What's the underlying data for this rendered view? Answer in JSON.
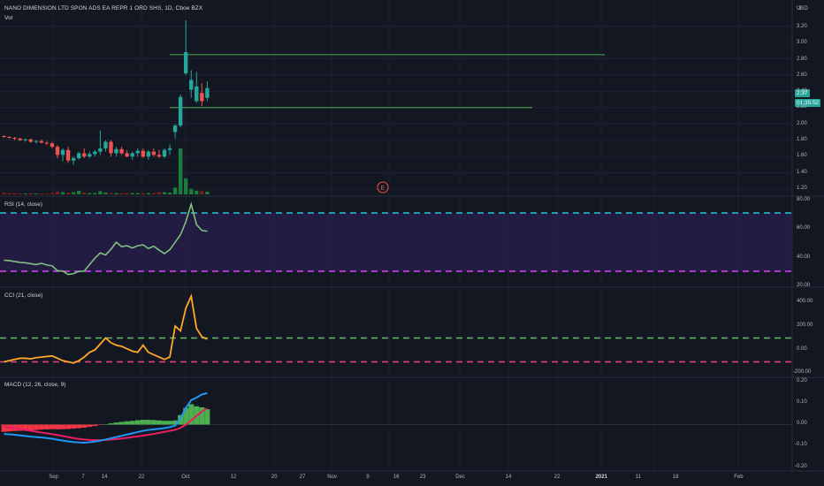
{
  "header": {
    "title": "NANO DIMENSION LTD SPON ADS EA REPR 1 ORD SHS, 1D, Cboe BZX",
    "vol_label": "Vol",
    "currency": "USD"
  },
  "price_axis": {
    "ticks": [
      "3",
      "3.20",
      "3.00",
      "2.80",
      "2.60",
      "2.40",
      "2.20",
      "2.00",
      "1.80",
      "1.60",
      "1.40",
      "1.20"
    ],
    "last_price": "2.37",
    "countdown": "01:35:52"
  },
  "rsi_axis": [
    "80.00",
    "60.00",
    "40.00",
    "20.00"
  ],
  "cci_axis": [
    "400.00",
    "200.00",
    "0.00",
    "-200.00"
  ],
  "macd_axis": [
    "0.20",
    "0.10",
    "0.00",
    "-0.10",
    "-0.20"
  ],
  "time_axis": [
    "Sep",
    "7",
    "14",
    "22",
    "Oct",
    "12",
    "20",
    "27",
    "Nov",
    "9",
    "16",
    "23",
    "Dec",
    "14",
    "22",
    "2021",
    "11",
    "18",
    "Feb"
  ],
  "earnings_marker": "E",
  "colors": {
    "up": "#26a69a",
    "down": "#ef5350",
    "rsi_line": "#7fbf7f",
    "cci_line": "#ffa726",
    "macd_line": "#2196f3",
    "signal_line": "#e91e63",
    "hist_pos": "#4caf50",
    "hist_neg": "#f23645"
  },
  "chart_data": [
    {
      "type": "candlestick",
      "title": "NANO DIMENSION LTD SPON ADS EA REPR 1 ORD SHS, 1D, Cboe BZX",
      "ylim": [
        1.1,
        3.3
      ],
      "candles": [
        [
          1.85,
          1.86,
          1.83,
          1.84
        ],
        [
          1.84,
          1.85,
          1.82,
          1.83
        ],
        [
          1.83,
          1.84,
          1.8,
          1.82
        ],
        [
          1.82,
          1.83,
          1.79,
          1.8
        ],
        [
          1.8,
          1.82,
          1.78,
          1.81
        ],
        [
          1.81,
          1.82,
          1.77,
          1.78
        ],
        [
          1.78,
          1.8,
          1.76,
          1.79
        ],
        [
          1.79,
          1.81,
          1.76,
          1.77
        ],
        [
          1.77,
          1.79,
          1.74,
          1.76
        ],
        [
          1.76,
          1.78,
          1.7,
          1.72
        ],
        [
          1.72,
          1.74,
          1.58,
          1.62
        ],
        [
          1.62,
          1.7,
          1.54,
          1.68
        ],
        [
          1.68,
          1.72,
          1.52,
          1.55
        ],
        [
          1.55,
          1.6,
          1.5,
          1.58
        ],
        [
          1.58,
          1.66,
          1.56,
          1.64
        ],
        [
          1.64,
          1.7,
          1.58,
          1.6
        ],
        [
          1.6,
          1.66,
          1.58,
          1.63
        ],
        [
          1.63,
          1.68,
          1.6,
          1.66
        ],
        [
          1.66,
          1.92,
          1.62,
          1.7
        ],
        [
          1.7,
          1.8,
          1.66,
          1.78
        ],
        [
          1.78,
          1.8,
          1.6,
          1.64
        ],
        [
          1.64,
          1.72,
          1.6,
          1.69
        ],
        [
          1.69,
          1.72,
          1.62,
          1.64
        ],
        [
          1.64,
          1.68,
          1.59,
          1.6
        ],
        [
          1.6,
          1.66,
          1.56,
          1.64
        ],
        [
          1.64,
          1.7,
          1.6,
          1.67
        ],
        [
          1.67,
          1.7,
          1.58,
          1.6
        ],
        [
          1.6,
          1.68,
          1.56,
          1.66
        ],
        [
          1.66,
          1.7,
          1.6,
          1.62
        ],
        [
          1.62,
          1.68,
          1.58,
          1.6
        ],
        [
          1.6,
          1.7,
          1.58,
          1.68
        ],
        [
          1.68,
          1.75,
          1.62,
          1.7
        ],
        [
          1.9,
          2.0,
          1.82,
          1.98
        ],
        [
          1.98,
          2.36,
          1.96,
          2.33
        ],
        [
          2.62,
          3.27,
          2.6,
          2.88
        ],
        [
          2.42,
          2.66,
          2.32,
          2.54
        ],
        [
          2.28,
          2.64,
          2.26,
          2.46
        ],
        [
          2.38,
          2.5,
          2.22,
          2.28
        ],
        [
          2.32,
          2.52,
          2.28,
          2.44
        ]
      ],
      "volume": [
        0.04,
        0.03,
        0.03,
        0.02,
        0.02,
        0.03,
        0.02,
        0.02,
        0.02,
        0.03,
        0.06,
        0.05,
        0.04,
        0.05,
        0.08,
        0.04,
        0.03,
        0.03,
        0.07,
        0.04,
        0.03,
        0.03,
        0.03,
        0.03,
        0.03,
        0.03,
        0.03,
        0.03,
        0.03,
        0.05,
        0.05,
        0.04,
        0.15,
        1.0,
        0.35,
        0.12,
        0.08,
        0.07,
        0.06
      ],
      "hlines": [
        2.85,
        2.2
      ]
    },
    {
      "type": "line",
      "title": "RSI (14, close)",
      "ylim": [
        20,
        80
      ],
      "bands": [
        70,
        30
      ],
      "values": [
        37.6,
        37.3,
        36.7,
        36.1,
        35.8,
        35.2,
        34.6,
        35.5,
        34.3,
        33.7,
        30.4,
        30.1,
        27.8,
        28.4,
        29.9,
        30.1,
        34.6,
        39.0,
        42.6,
        41.2,
        45.1,
        49.9,
        46.9,
        47.5,
        46.0,
        47.5,
        48.1,
        45.6,
        47.2,
        44.5,
        42.1,
        44.8,
        49.9,
        55.0,
        64.0,
        76.0,
        62.0,
        58.0,
        57.5
      ]
    },
    {
      "type": "line",
      "title": "CCI (21, close)",
      "ylim": [
        -200,
        450
      ],
      "bands": [
        100,
        -100
      ],
      "values": [
        -100,
        -90,
        -80,
        -70,
        -70,
        -75,
        -65,
        -60,
        -55,
        -50,
        -70,
        -90,
        -100,
        -110,
        -90,
        -60,
        -20,
        0,
        50,
        100,
        60,
        40,
        30,
        10,
        -10,
        -20,
        40,
        -20,
        -40,
        -60,
        -80,
        -60,
        200,
        160,
        350,
        450,
        180,
        110,
        90
      ]
    },
    {
      "type": "macd",
      "title": "MACD (12, 26, close, 9)",
      "ylim": [
        -0.2,
        0.2
      ],
      "macd": [
        -0.045,
        -0.047,
        -0.049,
        -0.052,
        -0.055,
        -0.058,
        -0.06,
        -0.062,
        -0.065,
        -0.068,
        -0.073,
        -0.077,
        -0.081,
        -0.084,
        -0.086,
        -0.087,
        -0.085,
        -0.082,
        -0.077,
        -0.072,
        -0.066,
        -0.06,
        -0.054,
        -0.048,
        -0.042,
        -0.036,
        -0.03,
        -0.026,
        -0.023,
        -0.02,
        -0.017,
        -0.012,
        -0.005,
        0.03,
        0.08,
        0.118,
        0.13,
        0.145,
        0.152
      ],
      "signal": [
        -0.01,
        -0.014,
        -0.018,
        -0.022,
        -0.026,
        -0.03,
        -0.034,
        -0.038,
        -0.042,
        -0.046,
        -0.05,
        -0.055,
        -0.06,
        -0.065,
        -0.069,
        -0.072,
        -0.074,
        -0.075,
        -0.075,
        -0.074,
        -0.072,
        -0.07,
        -0.067,
        -0.064,
        -0.06,
        -0.057,
        -0.053,
        -0.049,
        -0.045,
        -0.04,
        -0.035,
        -0.03,
        -0.025,
        -0.016,
        0.0,
        0.02,
        0.042,
        0.062,
        0.078
      ],
      "histogram": [
        -0.035,
        -0.033,
        -0.031,
        -0.03,
        -0.029,
        -0.028,
        -0.026,
        -0.024,
        -0.023,
        -0.022,
        -0.023,
        -0.022,
        -0.021,
        -0.019,
        -0.017,
        -0.015,
        -0.011,
        -0.007,
        -0.002,
        0.002,
        0.006,
        0.01,
        0.013,
        0.016,
        0.018,
        0.021,
        0.023,
        0.023,
        0.022,
        0.02,
        0.018,
        0.018,
        0.02,
        0.046,
        0.08,
        0.098,
        0.088,
        0.083,
        0.074
      ]
    }
  ]
}
